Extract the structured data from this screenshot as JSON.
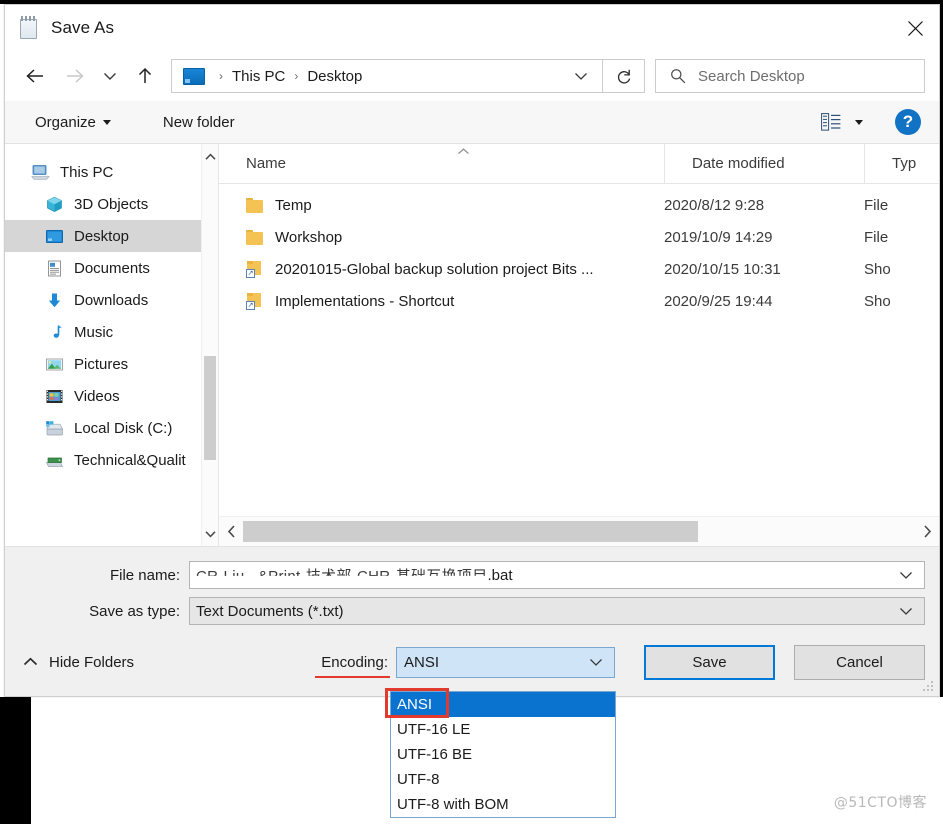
{
  "window": {
    "title": "Save As",
    "title_icon": "notepad-icon",
    "close_icon": "close-icon"
  },
  "nav": {
    "back_icon": "arrow-left-icon",
    "forward_icon": "arrow-right-icon",
    "recent_icon": "chevron-down-icon",
    "up_icon": "arrow-up-icon",
    "breadcrumb": {
      "root_icon": "this-pc-icon",
      "items": [
        "This PC",
        "Desktop"
      ],
      "separator": "›"
    },
    "address_chevron_icon": "chevron-down-icon",
    "refresh_icon": "refresh-icon",
    "search": {
      "icon": "search-icon",
      "placeholder": "Search Desktop",
      "value": ""
    }
  },
  "toolbar": {
    "organize_label": "Organize",
    "new_folder_label": "New folder",
    "view_icon": "list-view-icon",
    "view_caret_icon": "caret-down-icon",
    "help_icon": "help-icon",
    "help_label": "?"
  },
  "sidebar": {
    "scroll_up_icon": "chevron-up-icon",
    "scroll_down_icon": "chevron-down-icon",
    "items": [
      {
        "label": "This PC",
        "icon": "this-pc-icon",
        "indent": false,
        "selected": false
      },
      {
        "label": "3D Objects",
        "icon": "3d-objects-icon",
        "indent": true,
        "selected": false
      },
      {
        "label": "Desktop",
        "icon": "desktop-icon",
        "indent": true,
        "selected": true
      },
      {
        "label": "Documents",
        "icon": "documents-icon",
        "indent": true,
        "selected": false
      },
      {
        "label": "Downloads",
        "icon": "downloads-icon",
        "indent": true,
        "selected": false
      },
      {
        "label": "Music",
        "icon": "music-icon",
        "indent": true,
        "selected": false
      },
      {
        "label": "Pictures",
        "icon": "pictures-icon",
        "indent": true,
        "selected": false
      },
      {
        "label": "Videos",
        "icon": "videos-icon",
        "indent": true,
        "selected": false
      },
      {
        "label": "Local Disk (C:)",
        "icon": "local-disk-icon",
        "indent": true,
        "selected": false
      },
      {
        "label": "Technical&Qualit",
        "icon": "network-drive-icon",
        "indent": true,
        "selected": false
      }
    ]
  },
  "filelist": {
    "columns": [
      "Name",
      "Date modified",
      "Typ"
    ],
    "sort_indicator": "⌃",
    "rows": [
      {
        "name": "Temp",
        "date": "2020/8/12 9:28",
        "type": "File",
        "icon": "folder-icon"
      },
      {
        "name": "Workshop",
        "date": "2019/10/9 14:29",
        "type": "File",
        "icon": "folder-icon"
      },
      {
        "name": "20201015-Global backup solution project Bits ...",
        "date": "2020/10/15 10:31",
        "type": "Sho",
        "icon": "shortcut-icon"
      },
      {
        "name": "Implementations - Shortcut",
        "date": "2020/9/25 19:44",
        "type": "Sho",
        "icon": "shortcut-icon"
      }
    ],
    "hscroll_left_icon": "chevron-left-icon",
    "hscroll_right_icon": "chevron-right-icon"
  },
  "form": {
    "file_name_label": "File name:",
    "file_name_value_redacted": "CR-Liu...&Print-技术部-CHR-基础互换项目",
    "file_name_extension": ".bat",
    "file_name_chevron_icon": "chevron-down-icon",
    "save_as_type_label": "Save as type:",
    "save_as_type_value": "Text Documents (*.txt)",
    "save_as_type_chevron_icon": "chevron-down-icon"
  },
  "actions": {
    "hide_folders_label": "Hide Folders",
    "hide_folders_icon": "chevron-up-icon",
    "encoding_label": "Encoding:",
    "encoding_value": "ANSI",
    "encoding_chevron_icon": "chevron-down-icon",
    "save_label": "Save",
    "cancel_label": "Cancel"
  },
  "encoding_dropdown": {
    "options": [
      "ANSI",
      "UTF-16 LE",
      "UTF-16 BE",
      "UTF-8",
      "UTF-8 with BOM"
    ],
    "selected_index": 0
  },
  "annotations": {
    "highlight_color": "#e23b2e"
  },
  "watermark": {
    "text": "@51CTO博客"
  }
}
